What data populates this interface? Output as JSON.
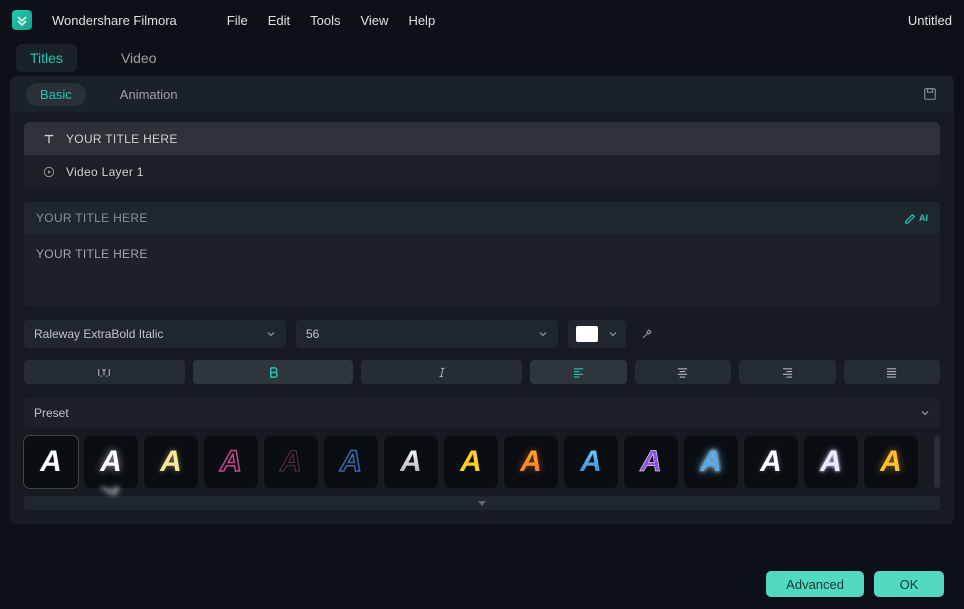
{
  "app": {
    "name": "Wondershare Filmora",
    "document": "Untitled"
  },
  "menu": {
    "file": "File",
    "edit": "Edit",
    "tools": "Tools",
    "view": "View",
    "help": "Help"
  },
  "mainTabs": {
    "titles": "Titles",
    "video": "Video"
  },
  "subTabs": {
    "basic": "Basic",
    "animation": "Animation"
  },
  "layers": {
    "title": "YOUR TITLE HERE",
    "video": "Video Layer 1"
  },
  "preview": {
    "header": "YOUR TITLE HERE",
    "text": "YOUR TITLE HERE"
  },
  "font": {
    "family": "Raleway ExtraBold Italic",
    "size": "56",
    "color": "#ffffff"
  },
  "preset": {
    "label": "Preset"
  },
  "footer": {
    "advanced": "Advanced",
    "ok": "OK"
  }
}
